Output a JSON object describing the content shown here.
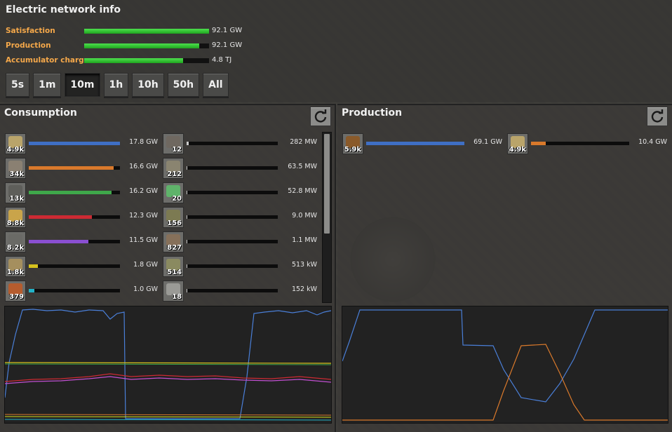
{
  "title": "Electric network info",
  "stats": [
    {
      "label": "Satisfaction",
      "value": "92.1 GW",
      "fill": 1.0
    },
    {
      "label": "Production",
      "value": "92.1 GW",
      "fill": 0.92
    },
    {
      "label": "Accumulator charge",
      "value": "4.8 TJ",
      "fill": 0.79
    }
  ],
  "time_buttons": [
    {
      "label": "5s",
      "active": false
    },
    {
      "label": "1m",
      "active": false
    },
    {
      "label": "10m",
      "active": true
    },
    {
      "label": "1h",
      "active": false
    },
    {
      "label": "10h",
      "active": false
    },
    {
      "label": "50h",
      "active": false
    },
    {
      "label": "All",
      "active": false
    }
  ],
  "consumption": {
    "title": "Consumption",
    "refresh_icon": "refresh-icon",
    "left_column": [
      {
        "count": "4.9k",
        "value": "17.8 GW",
        "fill": 1.0,
        "color": "#3f6fc4",
        "icon_color": "#b9a46a"
      },
      {
        "count": "34k",
        "value": "16.6 GW",
        "fill": 0.93,
        "color": "#d9792b",
        "icon_color": "#8a8072"
      },
      {
        "count": "13k",
        "value": "16.2 GW",
        "fill": 0.91,
        "color": "#3fa84a",
        "icon_color": "#5e5e5a"
      },
      {
        "count": "8.8k",
        "value": "12.3 GW",
        "fill": 0.69,
        "color": "#cc2a33",
        "icon_color": "#c9a44a"
      },
      {
        "count": "8.2k",
        "value": "11.5 GW",
        "fill": 0.65,
        "color": "#8a4fd1",
        "icon_color": "#6a6a66"
      },
      {
        "count": "1.8k",
        "value": "1.8 GW",
        "fill": 0.1,
        "color": "#d6c21d",
        "icon_color": "#a58f5e"
      },
      {
        "count": "379",
        "value": "1.0 GW",
        "fill": 0.06,
        "color": "#22b3c9",
        "icon_color": "#b55c2e"
      }
    ],
    "right_column": [
      {
        "count": "12",
        "value": "282 MW",
        "fill": 0.02,
        "color": "#cccccc",
        "icon_color": "#6f6860"
      },
      {
        "count": "212",
        "value": "63.5 MW",
        "fill": 0.01,
        "color": "#cccccc",
        "icon_color": "#8a8470"
      },
      {
        "count": "20",
        "value": "52.8 MW",
        "fill": 0.01,
        "color": "#cccccc",
        "icon_color": "#5fb36a"
      },
      {
        "count": "156",
        "value": "9.0 MW",
        "fill": 0.005,
        "color": "#cccccc",
        "icon_color": "#7c7a52"
      },
      {
        "count": "827",
        "value": "1.1 MW",
        "fill": 0.003,
        "color": "#cccccc",
        "icon_color": "#86705a"
      },
      {
        "count": "514",
        "value": "513 kW",
        "fill": 0.002,
        "color": "#cccccc",
        "icon_color": "#8a8a60"
      },
      {
        "count": "18",
        "value": "152 kW",
        "fill": 0.001,
        "color": "#cccccc",
        "icon_color": "#9a9a96"
      }
    ]
  },
  "production": {
    "title": "Production",
    "refresh_icon": "refresh-icon",
    "entries": [
      {
        "count": "5.9k",
        "value": "69.1 GW",
        "fill": 1.0,
        "color": "#3f6fc4",
        "icon_color": "#8a5a2a"
      },
      {
        "count": "4.9k",
        "value": "10.4 GW",
        "fill": 0.15,
        "color": "#d9792b",
        "icon_color": "#b9a46a"
      }
    ]
  }
}
